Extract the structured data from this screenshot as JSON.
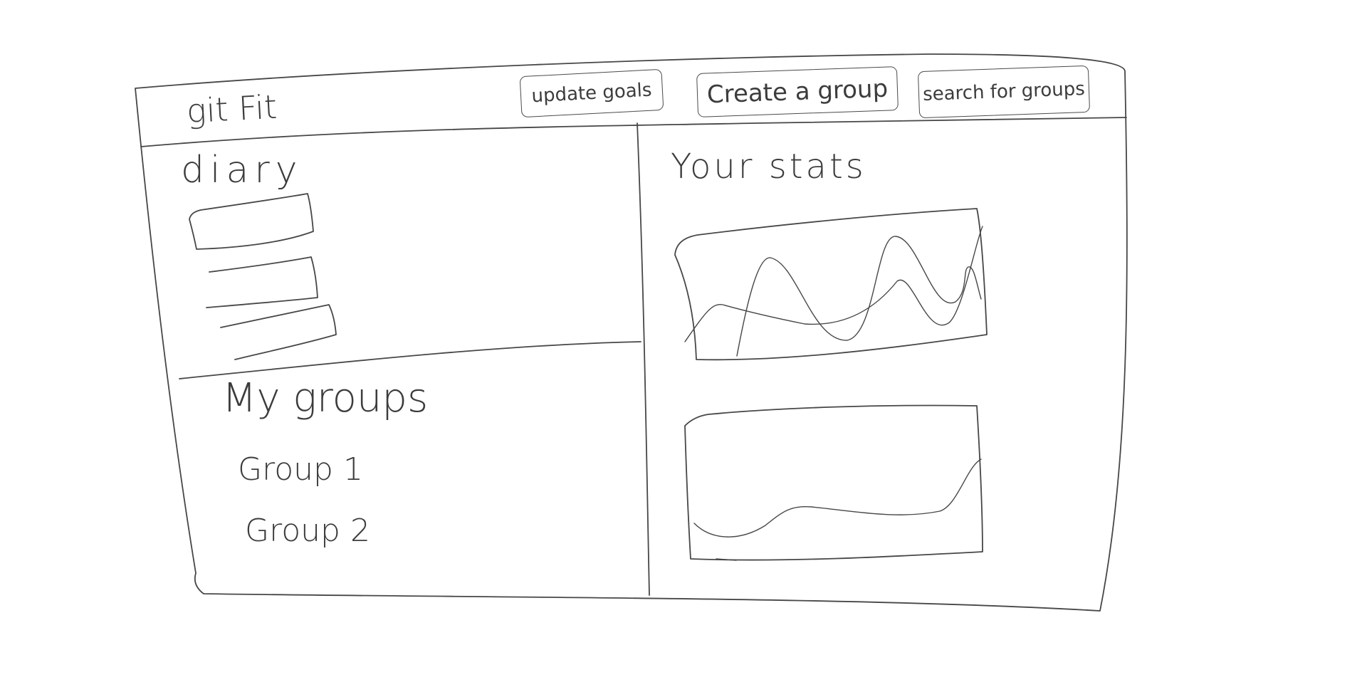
{
  "header": {
    "app_title": "git Fit",
    "buttons": {
      "update_goals": "update goals",
      "create_group": "Create a group",
      "search_groups": "search for groups"
    }
  },
  "diary": {
    "title": "diary",
    "entries": 3
  },
  "groups": {
    "title": "My groups",
    "items": [
      "Group 1",
      "Group 2"
    ]
  },
  "stats": {
    "title": "Your stats",
    "charts": 2
  }
}
